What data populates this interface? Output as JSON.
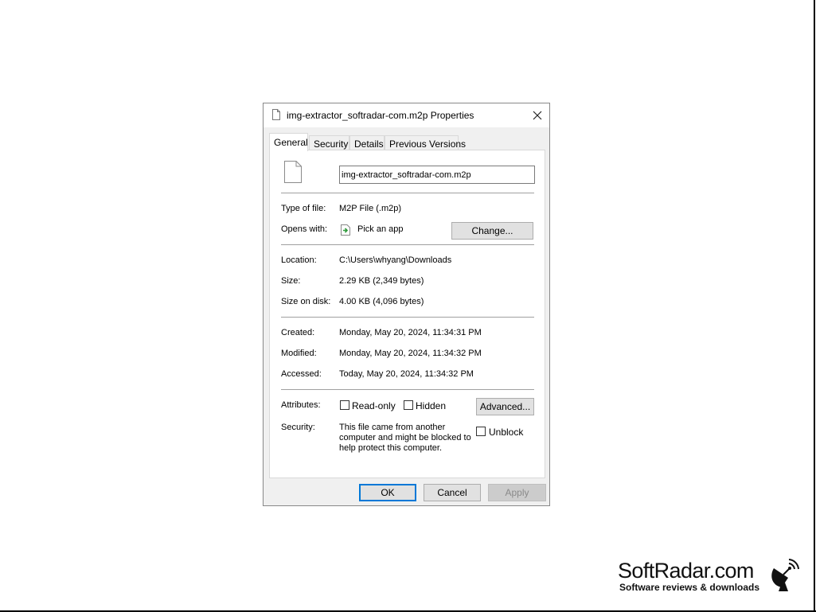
{
  "dialog": {
    "title": "img-extractor_softradar-com.m2p Properties",
    "tabs": [
      {
        "label": "General",
        "active": true
      },
      {
        "label": "Security",
        "active": false
      },
      {
        "label": "Details",
        "active": false
      },
      {
        "label": "Previous Versions",
        "active": false
      }
    ],
    "file_name": "img-extractor_softradar-com.m2p",
    "type_of_file": {
      "label": "Type of file:",
      "value": "M2P File (.m2p)"
    },
    "opens_with": {
      "label": "Opens with:",
      "value": "Pick an app",
      "change_button": "Change..."
    },
    "location": {
      "label": "Location:",
      "value": "C:\\Users\\whyang\\Downloads"
    },
    "size": {
      "label": "Size:",
      "value": "2.29 KB (2,349 bytes)"
    },
    "size_on_disk": {
      "label": "Size on disk:",
      "value": "4.00 KB (4,096 bytes)"
    },
    "created": {
      "label": "Created:",
      "value": "Monday, May 20, 2024, 11:34:31 PM"
    },
    "modified": {
      "label": "Modified:",
      "value": "Monday, May 20, 2024, 11:34:32 PM"
    },
    "accessed": {
      "label": "Accessed:",
      "value": "Today, May 20, 2024, 11:34:32 PM"
    },
    "attributes": {
      "label": "Attributes:",
      "read_only": {
        "label": "Read-only",
        "checked": false
      },
      "hidden": {
        "label": "Hidden",
        "checked": false
      },
      "advanced_button": "Advanced..."
    },
    "security": {
      "label": "Security:",
      "lines": [
        "This file came from another",
        "computer and might be blocked to",
        "help protect this computer."
      ],
      "unblock": {
        "label": "Unblock",
        "checked": false
      }
    },
    "buttons": {
      "ok": "OK",
      "cancel": "Cancel",
      "apply": "Apply"
    }
  },
  "watermark": {
    "title": "SoftRadar.com",
    "subtitle": "Software reviews & downloads"
  },
  "colors": {
    "accent": "#0078d7",
    "dialog_bg": "#f0f0f0",
    "app_icon_green": "#2e9a3a"
  }
}
